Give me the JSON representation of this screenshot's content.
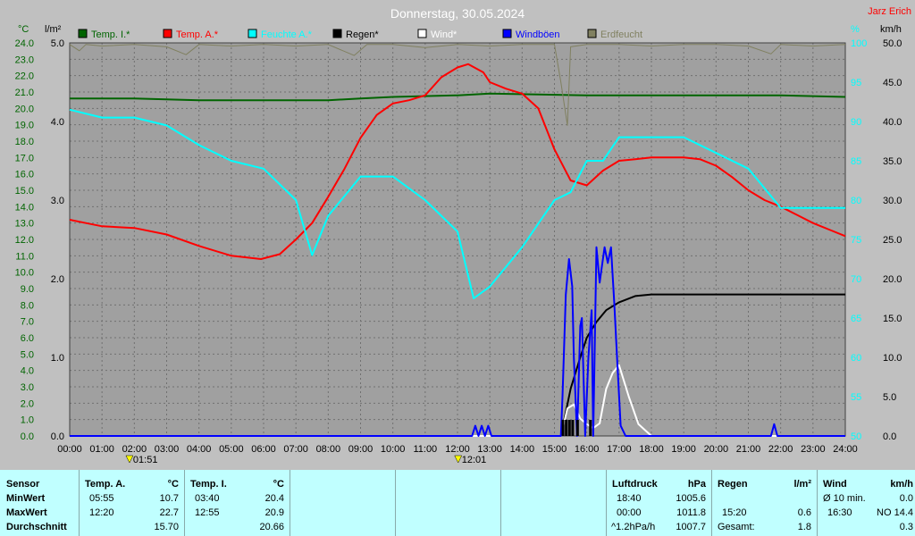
{
  "header": {
    "title": "Donnerstag, 30.05.2024",
    "author": "Jarz Erich"
  },
  "units": {
    "temp": "°C",
    "rain": "l/m²",
    "humidity": "%",
    "wind": "km/h"
  },
  "legend": [
    {
      "label": "Temp. I.*",
      "color": "#006400"
    },
    {
      "label": "Temp. A.*",
      "color": "#ff0000"
    },
    {
      "label": "Feuchte A.*",
      "color": "#00ffff"
    },
    {
      "label": "Regen*",
      "color": "#000000"
    },
    {
      "label": "Wind*",
      "color": "#ffffff"
    },
    {
      "label": "Windböen",
      "color": "#0000ff"
    },
    {
      "label": "Erdfeucht",
      "color": "#808060"
    }
  ],
  "markers": [
    {
      "label": "01:51",
      "hour": 1.85
    },
    {
      "label": "12:01",
      "hour": 12.02
    }
  ],
  "chart_data": {
    "type": "line",
    "title": "Donnerstag, 30.05.2024",
    "x_range": [
      0,
      24
    ],
    "x_ticks": [
      "00:00",
      "01:00",
      "02:00",
      "03:00",
      "04:00",
      "05:00",
      "06:00",
      "07:00",
      "08:00",
      "09:00",
      "10:00",
      "11:00",
      "12:00",
      "13:00",
      "14:00",
      "15:00",
      "16:00",
      "17:00",
      "18:00",
      "19:00",
      "20:00",
      "21:00",
      "22:00",
      "23:00",
      "24:00"
    ],
    "axes": {
      "temp": {
        "range": [
          0,
          24
        ],
        "ticks": [
          "0.0",
          "1.0",
          "2.0",
          "3.0",
          "4.0",
          "5.0",
          "6.0",
          "7.0",
          "8.0",
          "9.0",
          "10.0",
          "11.0",
          "12.0",
          "13.0",
          "14.0",
          "15.0",
          "16.0",
          "17.0",
          "18.0",
          "19.0",
          "20.0",
          "21.0",
          "22.0",
          "23.0",
          "24.0"
        ]
      },
      "rain": {
        "range": [
          0,
          5
        ],
        "ticks": [
          "0.0",
          "1.0",
          "2.0",
          "3.0",
          "4.0",
          "5.0"
        ]
      },
      "humidity": {
        "range": [
          50,
          100
        ],
        "ticks": [
          "50",
          "55",
          "60",
          "65",
          "70",
          "75",
          "80",
          "85",
          "90",
          "95",
          "100"
        ]
      },
      "wind": {
        "range": [
          0,
          50
        ],
        "ticks": [
          "0.0",
          "5.0",
          "10.0",
          "15.0",
          "20.0",
          "25.0",
          "30.0",
          "35.0",
          "40.0",
          "45.0",
          "50.0"
        ]
      }
    },
    "grid": true,
    "series": [
      {
        "name": "Temp. I.*",
        "axis": "temp",
        "color": "#006400",
        "x": [
          0,
          2,
          4,
          6,
          8,
          9,
          10,
          12,
          13,
          16,
          18,
          20,
          22,
          24
        ],
        "y": [
          20.6,
          20.6,
          20.5,
          20.5,
          20.5,
          20.6,
          20.7,
          20.8,
          20.9,
          20.8,
          20.8,
          20.8,
          20.8,
          20.7
        ]
      },
      {
        "name": "Temp. A.*",
        "axis": "temp",
        "color": "#ff0000",
        "x": [
          0,
          0.5,
          1,
          2,
          3,
          4,
          5,
          5.92,
          6.5,
          7,
          7.5,
          8,
          8.5,
          9,
          9.5,
          10,
          10.5,
          11,
          11.5,
          12,
          12.33,
          12.8,
          13,
          13.5,
          14,
          14.5,
          15,
          15.5,
          16,
          16.5,
          17,
          17.5,
          18,
          18.5,
          19,
          19.5,
          20,
          20.5,
          21,
          21.5,
          22,
          22.5,
          23,
          23.5,
          24
        ],
        "y": [
          13.2,
          13.0,
          12.8,
          12.7,
          12.3,
          11.6,
          11.0,
          10.8,
          11.1,
          12.0,
          13.0,
          14.6,
          16.3,
          18.2,
          19.6,
          20.3,
          20.5,
          20.8,
          21.9,
          22.5,
          22.7,
          22.2,
          21.6,
          21.2,
          20.9,
          20.0,
          17.5,
          15.6,
          15.3,
          16.2,
          16.8,
          16.9,
          17.0,
          17.0,
          17.0,
          16.9,
          16.5,
          15.8,
          15.0,
          14.4,
          14.0,
          13.5,
          13.0,
          12.6,
          12.2
        ]
      },
      {
        "name": "Feuchte A.*",
        "axis": "humidity",
        "color": "#00ffff",
        "x": [
          0,
          1,
          2,
          3,
          4,
          5,
          6,
          7,
          7.5,
          8,
          9,
          10,
          11,
          12,
          12.5,
          13,
          14,
          15,
          15.5,
          16,
          16.5,
          17,
          18,
          19,
          20,
          21,
          22,
          23,
          24
        ],
        "y": [
          91.5,
          90.5,
          90.5,
          89.5,
          87,
          85,
          84,
          80,
          73,
          78,
          83,
          83,
          80,
          76,
          67.5,
          69,
          74,
          80,
          81,
          85,
          85,
          88,
          88,
          88,
          86,
          84,
          79,
          79,
          79
        ]
      },
      {
        "name": "Regen*",
        "axis": "rain",
        "color": "#000000",
        "x": [
          0,
          15.2,
          15.5,
          15.8,
          16,
          16.3,
          16.6,
          17,
          17.5,
          18,
          19,
          20,
          21,
          22,
          23,
          24
        ],
        "y": [
          0,
          0,
          0.6,
          1.0,
          1.25,
          1.45,
          1.6,
          1.7,
          1.78,
          1.8,
          1.8,
          1.8,
          1.8,
          1.8,
          1.8,
          1.8
        ]
      },
      {
        "name": "Wind*",
        "axis": "wind",
        "color": "#ffffff",
        "x": [
          0,
          15.2,
          15.4,
          15.6,
          15.8,
          16,
          16.2,
          16.4,
          16.6,
          16.8,
          17,
          17.3,
          17.6,
          18,
          24
        ],
        "y": [
          0,
          0,
          3.5,
          4,
          2.2,
          1.5,
          1.0,
          1.6,
          6,
          8,
          9,
          5,
          1.5,
          0,
          0
        ]
      },
      {
        "name": "Windböen",
        "axis": "wind",
        "color": "#0000ff",
        "x": [
          0,
          12.45,
          12.55,
          12.65,
          12.75,
          12.85,
          12.95,
          13.05,
          13.15,
          15.2,
          15.25,
          15.35,
          15.45,
          15.55,
          15.6,
          15.7,
          15.8,
          15.85,
          15.95,
          16.05,
          16.15,
          16.2,
          16.3,
          16.4,
          16.45,
          16.55,
          16.65,
          16.75,
          16.85,
          16.95,
          17.05,
          17.2,
          17.35,
          21.7,
          21.8,
          21.9,
          24
        ],
        "y": [
          0,
          0,
          1.3,
          0,
          1.3,
          0,
          1.3,
          0,
          0,
          0,
          5,
          18,
          22.5,
          19,
          10,
          0,
          14,
          15,
          0,
          10,
          16,
          0,
          24,
          19.5,
          21,
          24,
          22,
          24,
          17,
          9,
          1.3,
          0,
          0,
          0,
          1.5,
          0,
          0
        ]
      },
      {
        "name": "Erdfeucht",
        "axis": "humidity",
        "color": "#808060",
        "x": [
          0,
          0.3,
          0.5,
          1,
          2,
          3,
          3.6,
          4,
          5,
          6,
          7,
          8,
          8.8,
          9.2,
          10,
          11,
          12,
          13,
          14,
          15,
          15.2,
          15.4,
          15.5,
          16,
          17,
          18,
          19,
          20,
          21,
          21.7,
          22,
          23,
          24
        ],
        "y": [
          99.8,
          99,
          99.8,
          99.6,
          99.8,
          99.5,
          98.5,
          99.8,
          99.6,
          99.8,
          99.6,
          99.8,
          98.4,
          99.8,
          99.8,
          99.4,
          99.8,
          99.6,
          99.8,
          99.8,
          95,
          89.5,
          99.5,
          99.8,
          99.8,
          99.6,
          99.8,
          99.8,
          99.6,
          98.6,
          99.8,
          99.6,
          99.8
        ]
      }
    ]
  },
  "stats": {
    "sensor_label": "Sensor",
    "rows": [
      "MinWert",
      "MaxWert",
      "Durchschnitt"
    ],
    "temp_a": {
      "header": "Temp. A.",
      "unit": "°C",
      "times": [
        "05:55",
        "12:20",
        ""
      ],
      "values": [
        "10.7",
        "22.7",
        "15.70"
      ]
    },
    "temp_i": {
      "header": "Temp. I.",
      "unit": "°C",
      "times": [
        "03:40",
        "12:55",
        ""
      ],
      "values": [
        "20.4",
        "20.9",
        "20.66"
      ]
    },
    "pressure": {
      "header": "Luftdruck",
      "unit": "hPa",
      "times": [
        "18:40",
        "00:00",
        "^1.2hPa/h"
      ],
      "values": [
        "1005.6",
        "1011.8",
        "1007.7"
      ]
    },
    "rain": {
      "header": "Regen",
      "unit": "l/m²",
      "times": [
        "",
        "15:20",
        "Gesamt:"
      ],
      "values": [
        "",
        "0.6",
        "1.8"
      ]
    },
    "wind": {
      "header": "Wind",
      "unit": "km/h",
      "times": [
        "Ø 10 min.",
        "16:30",
        ""
      ],
      "values": [
        "0.0",
        "NO 14.4",
        "0.3"
      ]
    }
  }
}
